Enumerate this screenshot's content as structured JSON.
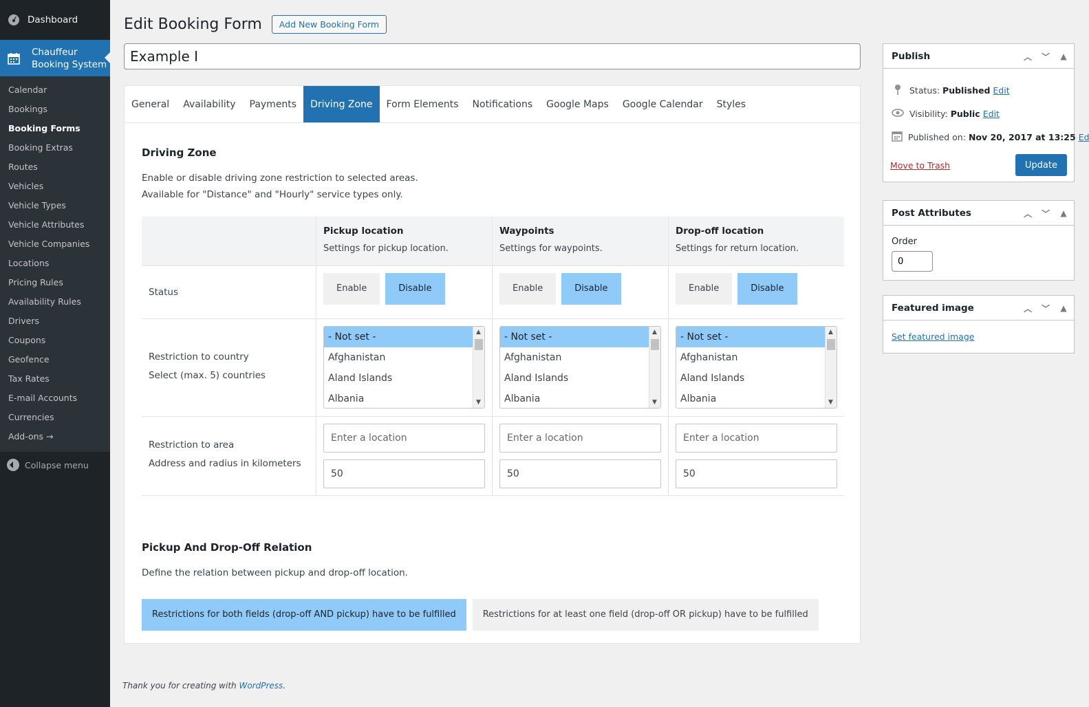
{
  "sidebar": {
    "dashboard": "Dashboard",
    "plugin": "Chauffeur Booking System",
    "items": [
      "Calendar",
      "Bookings",
      "Booking Forms",
      "Booking Extras",
      "Routes",
      "Vehicles",
      "Vehicle Types",
      "Vehicle Attributes",
      "Vehicle Companies",
      "Locations",
      "Pricing Rules",
      "Availability Rules",
      "Drivers",
      "Coupons",
      "Geofence",
      "Tax Rates",
      "E-mail Accounts",
      "Currencies",
      "Add-ons →"
    ],
    "active_item": "Booking Forms",
    "collapse": "Collapse menu"
  },
  "header": {
    "title": "Edit Booking Form",
    "add_new": "Add New Booking Form",
    "post_title": "Example I"
  },
  "tabs": [
    "General",
    "Availability",
    "Payments",
    "Driving Zone",
    "Form Elements",
    "Notifications",
    "Google Maps",
    "Google Calendar",
    "Styles"
  ],
  "active_tab": "Driving Zone",
  "driving_zone": {
    "title": "Driving Zone",
    "desc1": "Enable or disable driving zone restriction to selected areas.",
    "desc2": "Available for \"Distance\" and \"Hourly\" service types only.",
    "columns": [
      {
        "title": "Pickup location",
        "sub": "Settings for pickup location."
      },
      {
        "title": "Waypoints",
        "sub": "Settings for waypoints."
      },
      {
        "title": "Drop-off location",
        "sub": "Settings for return location."
      }
    ],
    "status_label": "Status",
    "enable": "Enable",
    "disable": "Disable",
    "country_label1": "Restriction to country",
    "country_label2": "Select (max. 5) countries",
    "countries": [
      "- Not set -",
      "Afghanistan",
      "Aland Islands",
      "Albania"
    ],
    "area_label1": "Restriction to area",
    "area_label2": "Address and radius in kilometers",
    "location_placeholder": "Enter a location",
    "radius": "50"
  },
  "relation": {
    "title": "Pickup And Drop-Off Relation",
    "desc": "Define the relation between pickup and drop-off location.",
    "opt_and": "Restrictions for both fields (drop-off AND pickup) have to be fulfilled",
    "opt_or": "Restrictions for at least one field (drop-off OR pickup) have to be fulfilled"
  },
  "publish": {
    "title": "Publish",
    "status_label": "Status:",
    "status_value": "Published",
    "visibility_label": "Visibility:",
    "visibility_value": "Public",
    "published_label": "Published on:",
    "published_value": "Nov 20, 2017 at 13:25",
    "edit": "Edit",
    "trash": "Move to Trash",
    "update": "Update"
  },
  "attributes": {
    "title": "Post Attributes",
    "order_label": "Order",
    "order_value": "0"
  },
  "featured": {
    "title": "Featured image",
    "link": "Set featured image"
  },
  "footer": {
    "text": "Thank you for creating with",
    "link": "WordPress",
    "end": "."
  },
  "colors": {
    "accent": "#2271b1",
    "toggle_on": "#90caf9",
    "sidebar_bg": "#1d2327"
  }
}
